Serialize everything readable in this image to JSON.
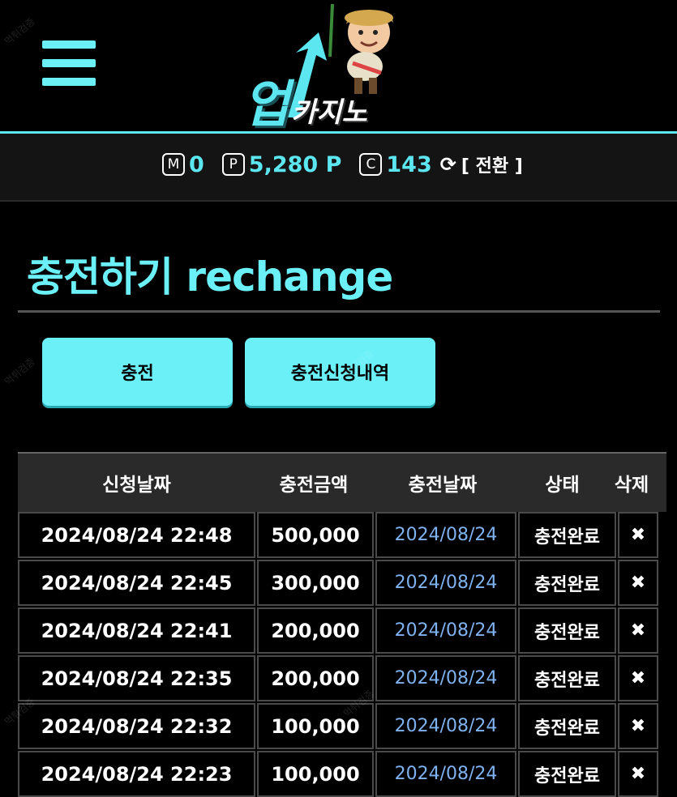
{
  "header": {
    "logo_big": "업",
    "logo_small": "카지노"
  },
  "balance": {
    "money_icon": "M",
    "money_value": "0",
    "point_icon": "P",
    "point_value": "5,280 P",
    "coin_icon": "C",
    "coin_value": "143",
    "switch_label": "[ 전환 ]"
  },
  "page": {
    "title": "충전하기 rechange"
  },
  "tabs": [
    {
      "label": "충전"
    },
    {
      "label": "충전신청내역"
    }
  ],
  "table": {
    "headers": [
      "신청날짜",
      "충전금액",
      "충전날짜",
      "상태",
      "삭제"
    ],
    "rows": [
      {
        "request_date": "2024/08/24 22:48",
        "amount": "500,000",
        "charge_date": "2024/08/24",
        "status": "충전완료",
        "delete": "✖"
      },
      {
        "request_date": "2024/08/24 22:45",
        "amount": "300,000",
        "charge_date": "2024/08/24",
        "status": "충전완료",
        "delete": "✖"
      },
      {
        "request_date": "2024/08/24 22:41",
        "amount": "200,000",
        "charge_date": "2024/08/24",
        "status": "충전완료",
        "delete": "✖"
      },
      {
        "request_date": "2024/08/24 22:35",
        "amount": "200,000",
        "charge_date": "2024/08/24",
        "status": "충전완료",
        "delete": "✖"
      },
      {
        "request_date": "2024/08/24 22:32",
        "amount": "100,000",
        "charge_date": "2024/08/24",
        "status": "충전완료",
        "delete": "✖"
      },
      {
        "request_date": "2024/08/24 22:23",
        "amount": "100,000",
        "charge_date": "2024/08/24",
        "status": "충전완료",
        "delete": "✖"
      }
    ]
  },
  "colors": {
    "accent": "#6cf0f7",
    "link_date": "#7fb2f0",
    "background": "#000000"
  }
}
